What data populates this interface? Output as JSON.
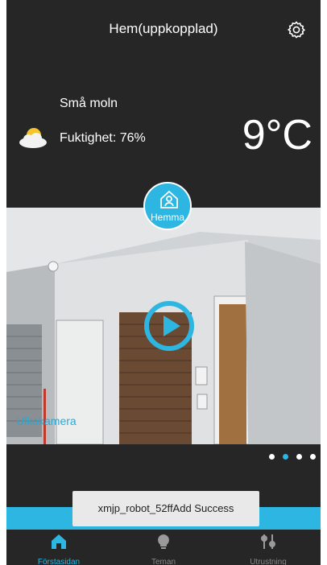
{
  "header": {
    "title": "Hem(uppkopplad)",
    "settings_icon": "gear-icon"
  },
  "weather": {
    "description": "Små moln",
    "humidity": "Fuktighet: 76%",
    "temperature": "9°C",
    "icon": "cloud-sun-icon"
  },
  "camera": {
    "name": "Ulkokamera",
    "mode_badge": "Hemma",
    "badge_icon": "home-person-icon",
    "play_icon": "play-icon"
  },
  "pager": {
    "count": 4,
    "active_index": 1
  },
  "toast": {
    "text": "xmjp_robot_52ffAdd Success"
  },
  "tabs": [
    {
      "label": "Förstasidan",
      "icon": "home-icon",
      "active": true
    },
    {
      "label": "Teman",
      "icon": "lightbulb-icon",
      "active": false
    },
    {
      "label": "Utrustning",
      "icon": "sliders-icon",
      "active": false
    }
  ],
  "colors": {
    "accent": "#2cb6e1",
    "background": "#262626"
  }
}
